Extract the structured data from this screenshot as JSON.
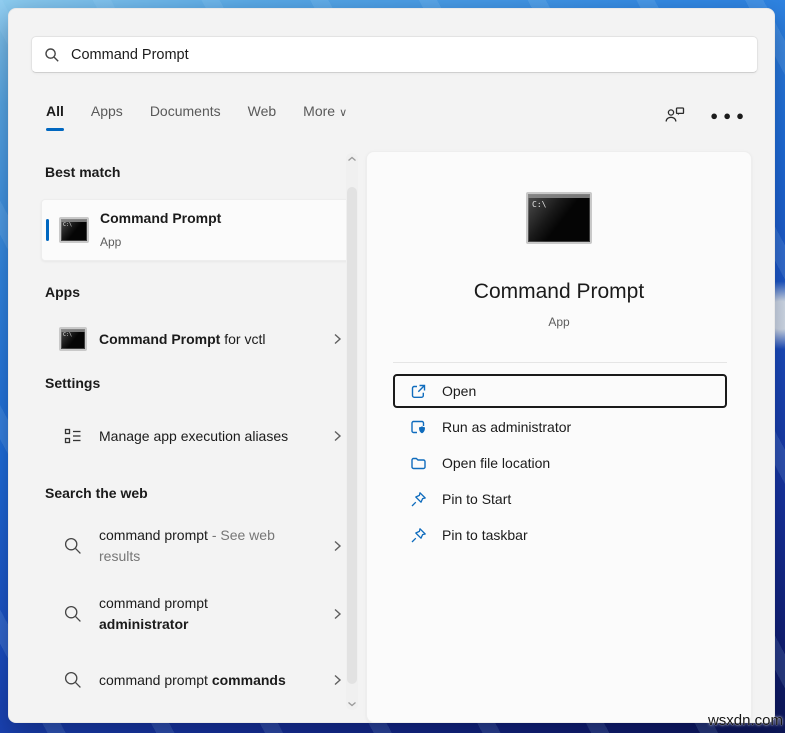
{
  "search": {
    "value": "Command Prompt"
  },
  "tabs": {
    "items": [
      {
        "label": "All",
        "active": true
      },
      {
        "label": "Apps",
        "active": false
      },
      {
        "label": "Documents",
        "active": false
      },
      {
        "label": "Web",
        "active": false
      },
      {
        "label": "More",
        "active": false,
        "chevron": "v"
      }
    ]
  },
  "left": {
    "best_match": {
      "heading": "Best match",
      "item": {
        "title": "Command Prompt",
        "subtitle": "App"
      }
    },
    "apps": {
      "heading": "Apps",
      "item": {
        "bold": "Command Prompt",
        "rest": " for vctl"
      }
    },
    "settings": {
      "heading": "Settings",
      "item": {
        "label": "Manage app execution aliases"
      }
    },
    "web": {
      "heading": "Search the web",
      "items": [
        {
          "query": "command prompt",
          "suffix": " - See web results",
          "bold": ""
        },
        {
          "query": "command prompt ",
          "suffix": "",
          "bold": "administrator"
        },
        {
          "query": "command prompt ",
          "suffix": "",
          "bold": "commands"
        }
      ]
    }
  },
  "preview": {
    "title": "Command Prompt",
    "subtitle": "App",
    "actions": [
      {
        "label": "Open",
        "icon": "open-external-icon",
        "focused": true
      },
      {
        "label": "Run as administrator",
        "icon": "admin-shield-icon",
        "focused": false
      },
      {
        "label": "Open file location",
        "icon": "folder-icon",
        "focused": false
      },
      {
        "label": "Pin to Start",
        "icon": "pin-icon",
        "focused": false
      },
      {
        "label": "Pin to taskbar",
        "icon": "pin-icon",
        "focused": false
      }
    ]
  },
  "icons": {
    "cmd_text": "C:\\",
    "search": "magnifier",
    "account": "person-with-chat-bubble",
    "more": "ellipsis"
  },
  "colors": {
    "accent": "#0067c0",
    "icon_blue": "#0f6cbd"
  },
  "watermark": "wsxdn.com"
}
